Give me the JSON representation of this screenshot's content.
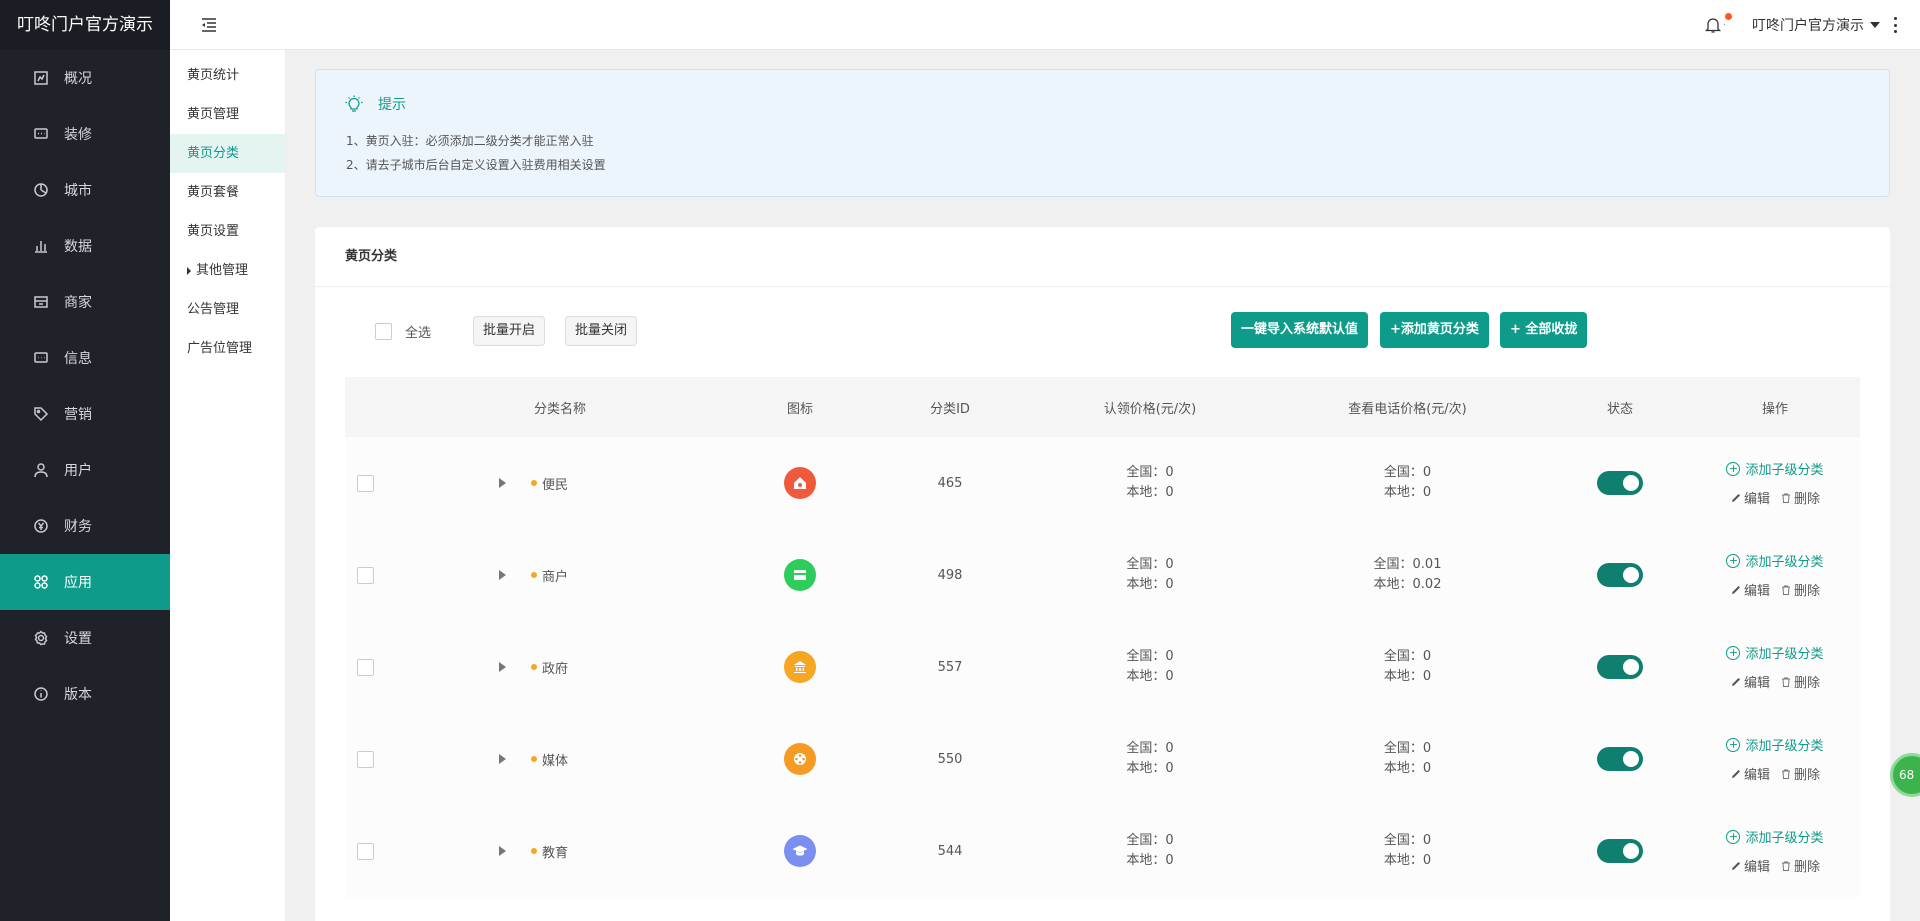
{
  "app": {
    "brand": "叮咚门户官方演示"
  },
  "sidebar": {
    "items": [
      {
        "label": "概况",
        "icon": "overview-icon"
      },
      {
        "label": "装修",
        "icon": "decor-icon"
      },
      {
        "label": "城市",
        "icon": "city-icon"
      },
      {
        "label": "数据",
        "icon": "data-icon"
      },
      {
        "label": "商家",
        "icon": "shop-icon"
      },
      {
        "label": "信息",
        "icon": "message-icon"
      },
      {
        "label": "营销",
        "icon": "tag-icon"
      },
      {
        "label": "用户",
        "icon": "user-icon"
      },
      {
        "label": "财务",
        "icon": "finance-icon"
      },
      {
        "label": "应用",
        "icon": "apps-icon",
        "active": true
      },
      {
        "label": "设置",
        "icon": "settings-icon"
      },
      {
        "label": "版本",
        "icon": "info-icon"
      }
    ]
  },
  "subnav": {
    "items": [
      {
        "label": "黄页统计"
      },
      {
        "label": "黄页管理"
      },
      {
        "label": "黄页分类",
        "active": true
      },
      {
        "label": "黄页套餐"
      },
      {
        "label": "黄页设置"
      },
      {
        "label": "其他管理"
      },
      {
        "label": "公告管理"
      },
      {
        "label": "广告位管理"
      }
    ]
  },
  "header": {
    "user": "叮咚门户官方演示"
  },
  "tip": {
    "title": "提示",
    "line1": "1、黄页入驻：必须添加二级分类才能正常入驻",
    "line2": "2、请去子城市后台自定义设置入驻费用相关设置"
  },
  "card": {
    "title": "黄页分类"
  },
  "toolbar": {
    "select_all": "全选",
    "batch_open": "批量开启",
    "batch_close": "批量关闭",
    "import_default": "一键导入系统默认值",
    "add_category": "+添加黄页分类",
    "collapse_all": "+ 全部收拢"
  },
  "table": {
    "headers": {
      "name": "分类名称",
      "icon": "图标",
      "id": "分类ID",
      "claim": "认领价格(元/次)",
      "phone": "查看电话价格(元/次)",
      "status": "状态",
      "ops": "操作"
    },
    "ops": {
      "add_child": "添加子级分类",
      "edit": "编辑",
      "delete": "删除"
    },
    "rows": [
      {
        "name": "便民",
        "id": "465",
        "claim_nat": "全国：0",
        "claim_loc": "本地：0",
        "phone_nat": "全国：0",
        "phone_loc": "本地：0",
        "icon_color": "#ef5a3c",
        "icon": "convenience-icon"
      },
      {
        "name": "商户",
        "id": "498",
        "claim_nat": "全国：0",
        "claim_loc": "本地：0",
        "phone_nat": "全国：0.01",
        "phone_loc": "本地：0.02",
        "icon_color": "#2ecc5a",
        "icon": "store-icon"
      },
      {
        "name": "政府",
        "id": "557",
        "claim_nat": "全国：0",
        "claim_loc": "本地：0",
        "phone_nat": "全国：0",
        "phone_loc": "本地：0",
        "icon_color": "#f5a623",
        "icon": "government-icon"
      },
      {
        "name": "媒体",
        "id": "550",
        "claim_nat": "全国：0",
        "claim_loc": "本地：0",
        "phone_nat": "全国：0",
        "phone_loc": "本地：0",
        "icon_color": "#f59a23",
        "icon": "film-icon"
      },
      {
        "name": "教育",
        "id": "544",
        "claim_nat": "全国：0",
        "claim_loc": "本地：0",
        "phone_nat": "全国：0",
        "phone_loc": "本地：0",
        "icon_color": "#7b8ff0",
        "icon": "graduation-cap-icon"
      }
    ]
  },
  "float_badge": {
    "text": "68"
  },
  "colors": {
    "accent": "#0f9b89",
    "sidebar_bg": "#1f2229",
    "toggle_on": "#0f7f6f"
  }
}
